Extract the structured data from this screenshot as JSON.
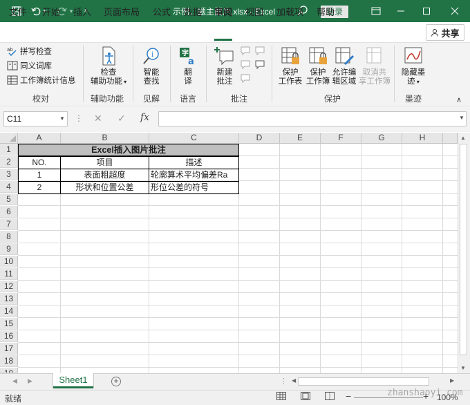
{
  "titlebar": {
    "title": "示例：题主图片.xlsx  -  Excel",
    "login_label": "登录",
    "colors": {
      "bg": "#217346"
    },
    "icons": [
      "save-icon",
      "undo-icon",
      "redo-icon",
      "customize-icon",
      "search-icon",
      "minimize-icon",
      "maximize-icon",
      "close-icon"
    ]
  },
  "menu": {
    "tabs": [
      "文件",
      "开始",
      "插入",
      "页面布局",
      "公式",
      "数据",
      "审阅",
      "视图",
      "加载项",
      "帮助"
    ],
    "active_tab": "审阅",
    "share_label": "共享"
  },
  "ribbon": {
    "proofing": {
      "spell": "拼写检查",
      "thesaurus": "同义词库",
      "stats": "工作簿统计信息",
      "label": "校对"
    },
    "accessibility": {
      "check_line1": "检查",
      "check_line2": "辅助功能",
      "label": "辅助功能"
    },
    "insights": {
      "smart_line1": "智能",
      "smart_line2": "查找",
      "label": "见解"
    },
    "language": {
      "translate_line1": "翻",
      "translate_line2": "译",
      "label": "语言"
    },
    "comments": {
      "new_line1": "新建",
      "new_line2": "批注",
      "label": "批注"
    },
    "protect": {
      "sheet_line1": "保护",
      "sheet_line2": "工作表",
      "book_line1": "保护",
      "book_line2": "工作簿",
      "allow_line1": "允许编",
      "allow_line2": "辑区域",
      "unshare_line1": "取消共",
      "unshare_line2": "享工作簿",
      "label": "保护"
    },
    "ink": {
      "hide_line1": "隐藏墨",
      "hide_line2": "迹",
      "label": "墨迹"
    }
  },
  "formula_bar": {
    "name_box": "C11",
    "fx": "fx",
    "formula": ""
  },
  "sheet": {
    "columns": [
      "A",
      "B",
      "C",
      "D",
      "E",
      "F",
      "G",
      "H"
    ],
    "rows": [
      "1",
      "2",
      "3",
      "4",
      "5",
      "6",
      "7",
      "8",
      "9",
      "10",
      "11",
      "12",
      "13",
      "14",
      "15",
      "16",
      "17",
      "18",
      "19"
    ],
    "title": "Excel插入图片批注",
    "headers": [
      "NO.",
      "项目",
      "描述"
    ],
    "data": [
      [
        "1",
        "表面粗超度",
        "轮廓算术平均偏差Ra"
      ],
      [
        "2",
        "形状和位置公差",
        "形位公差的符号"
      ]
    ]
  },
  "sheet_tabs": {
    "active": "Sheet1"
  },
  "status": {
    "ready": "就绪",
    "zoom": "100%",
    "watermark": "zhanshaoyi.com"
  }
}
